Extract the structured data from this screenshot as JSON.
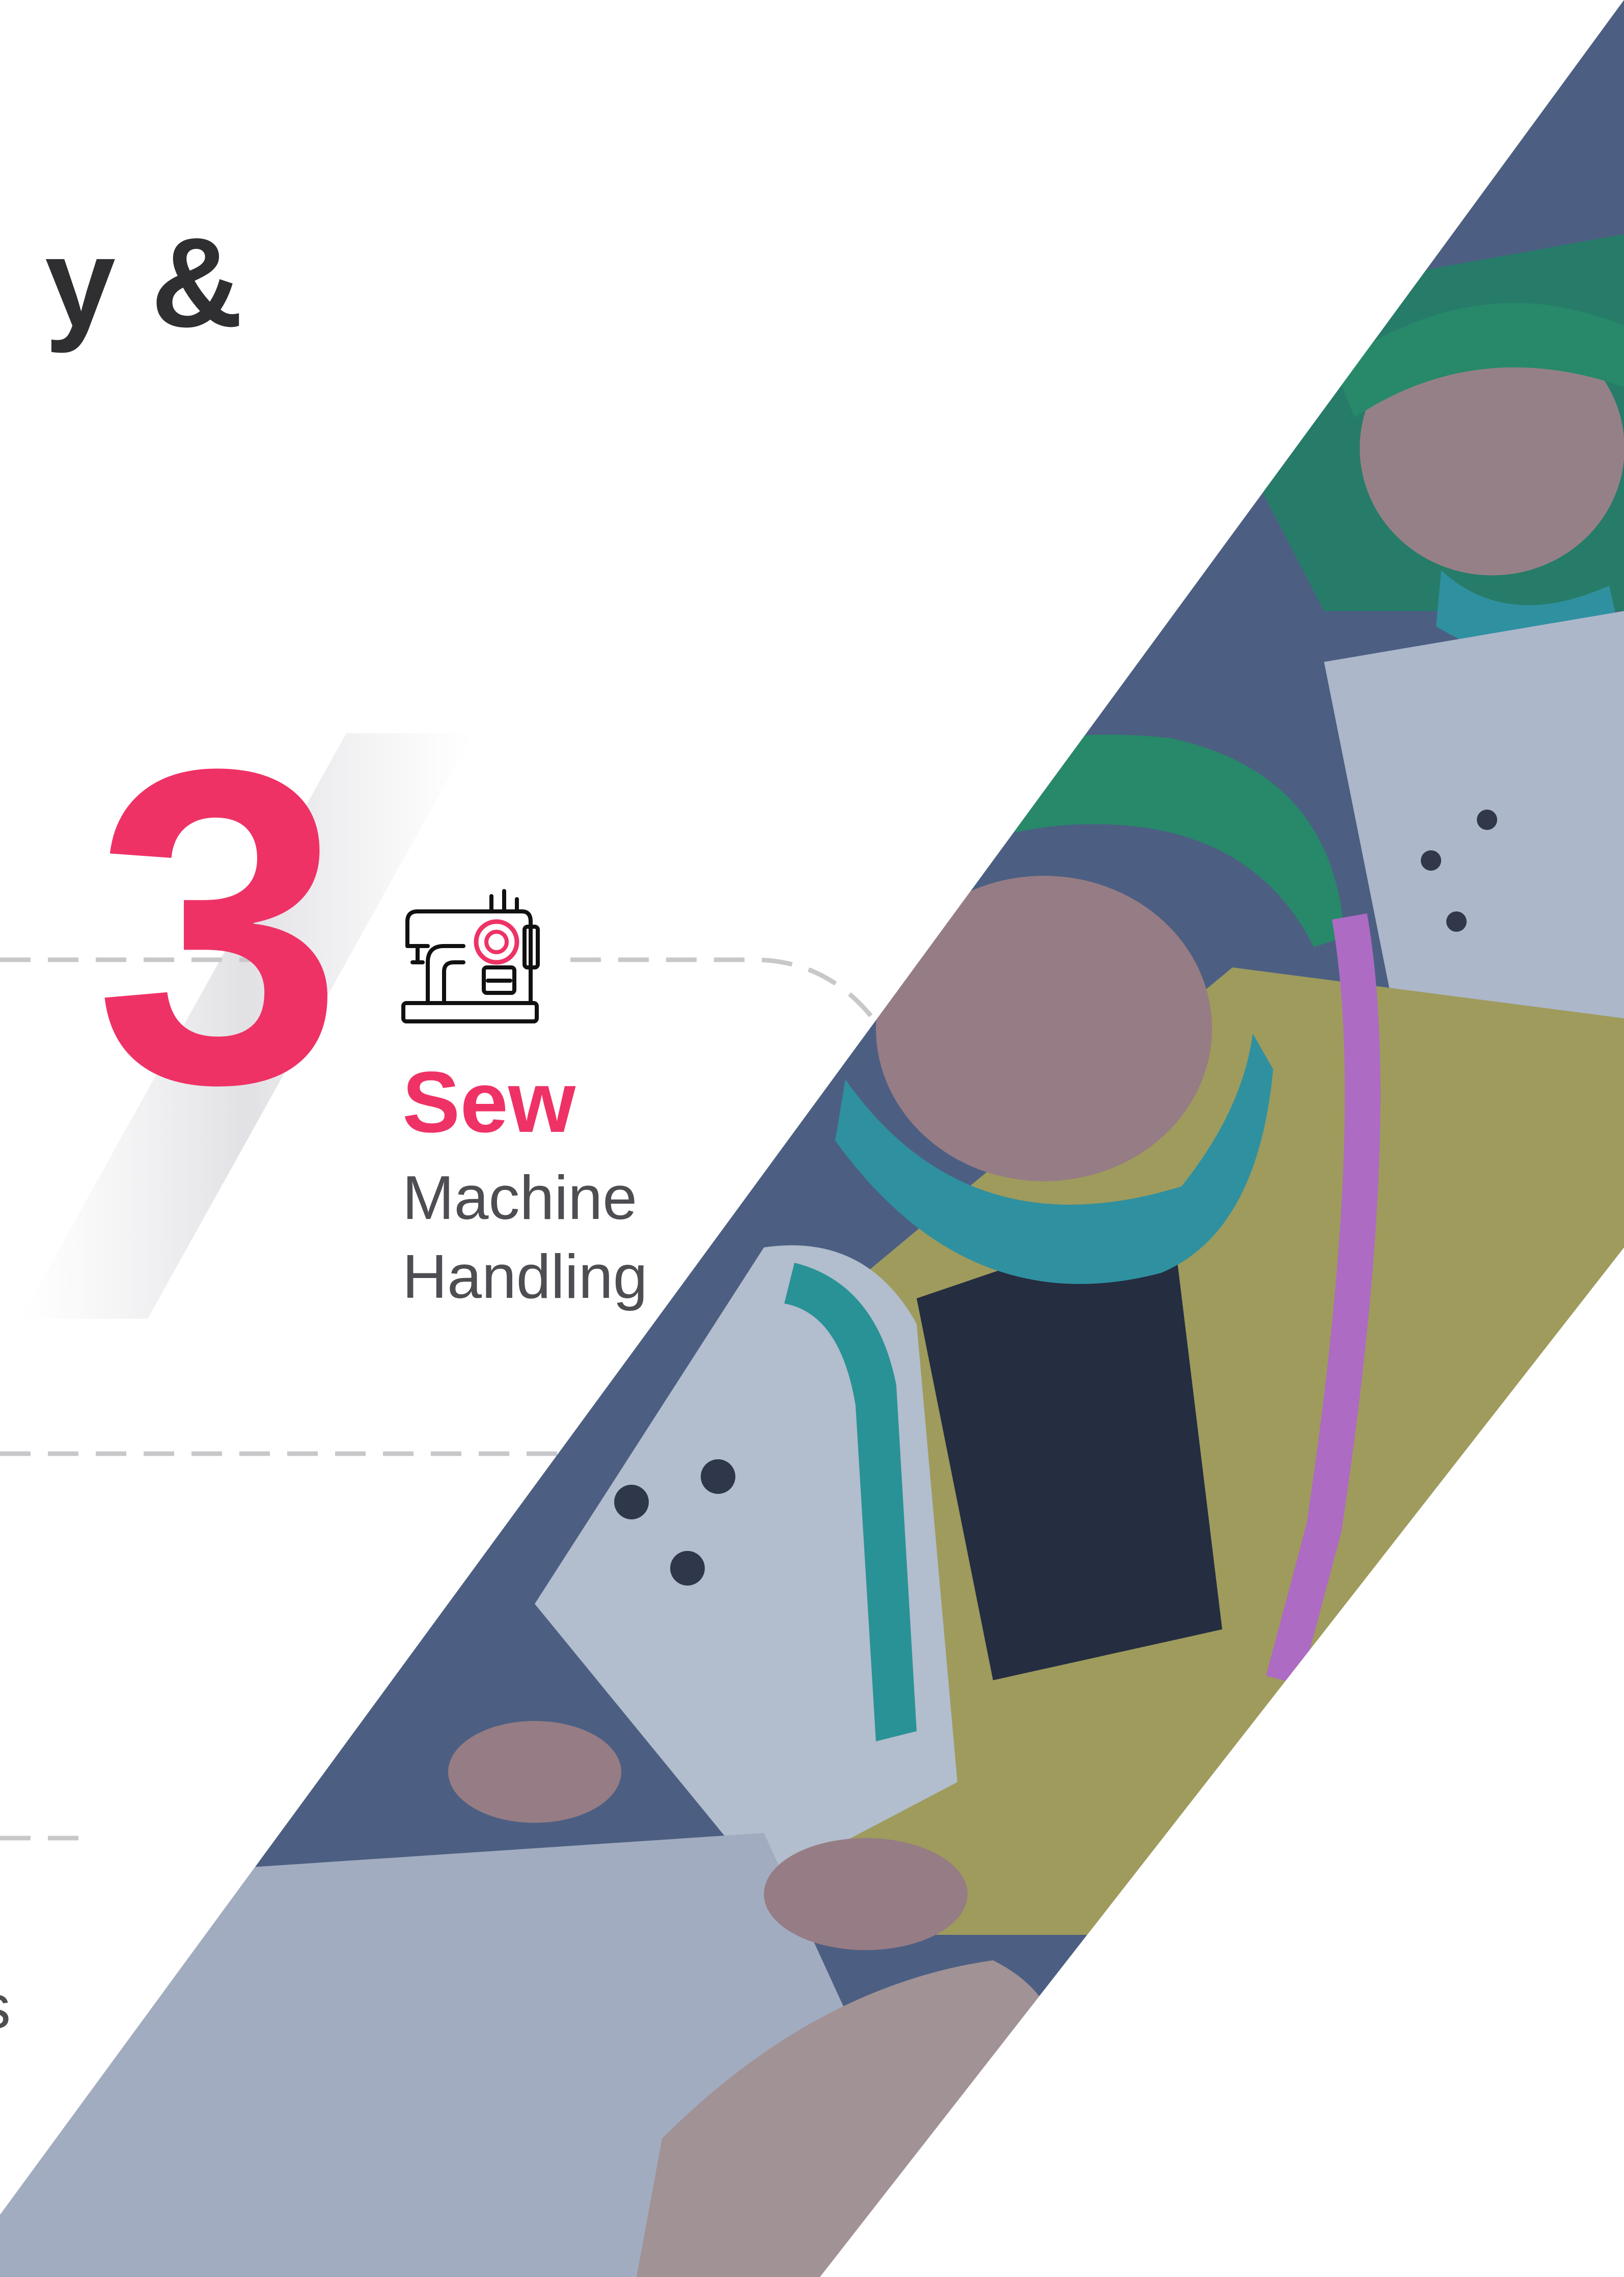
{
  "heading": {
    "fragment": "y &"
  },
  "step": {
    "number": "3",
    "title": "Sew",
    "description_lines": [
      "Machine",
      "Handling"
    ]
  },
  "icons": {
    "step_icon": "sewing-machine-icon"
  },
  "edge_fragment": "s",
  "colors": {
    "accent": "#ef3266",
    "heading": "#2f2f31",
    "body_text": "#4d4d52",
    "dashed_line": "#c8c8cb",
    "photo_overlay": "#3c5a8c"
  },
  "photo": {
    "subject": "garment workers at sewing machines"
  }
}
